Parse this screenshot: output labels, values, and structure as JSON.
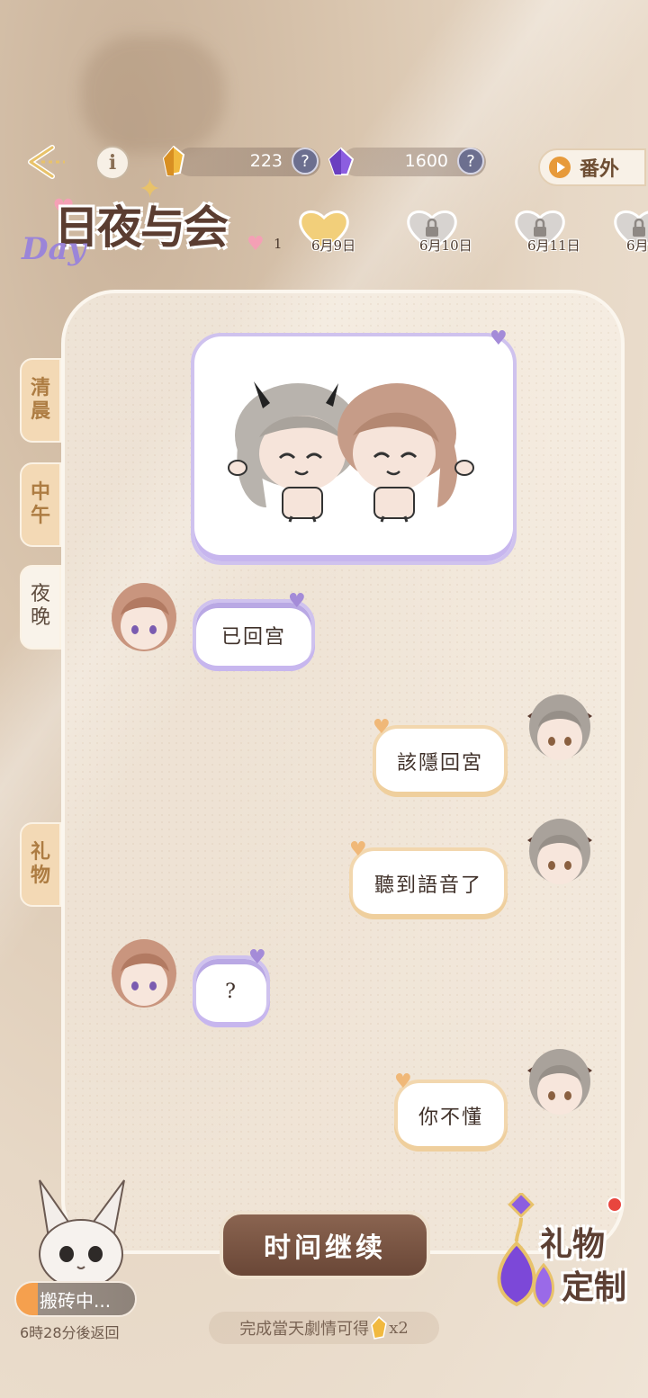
{
  "header": {
    "info_icon_text": "i",
    "gold_amount": "223",
    "gem_amount": "1600",
    "help_symbol": "?",
    "extra_button_label": "番外"
  },
  "logo": {
    "day_text": "Day",
    "title": "日夜与会"
  },
  "dates": {
    "partial_left": "1",
    "items": [
      "6月9日",
      "6月10日",
      "6月11日",
      "6月"
    ]
  },
  "side_tabs": {
    "morning": "清晨",
    "noon": "中午",
    "night": "夜晚",
    "gift": "礼物"
  },
  "chat": {
    "messages": [
      {
        "side": "left",
        "text": "已回宫"
      },
      {
        "side": "right",
        "text": "該隱回宮"
      },
      {
        "side": "right",
        "text": "聽到語音了"
      },
      {
        "side": "left",
        "text": "?"
      },
      {
        "side": "right",
        "text": "你不懂"
      }
    ]
  },
  "footer": {
    "continue_label": "时间继续",
    "reward_hint": "完成當天劇情可得",
    "reward_count": "x2",
    "status_label": "搬砖中...",
    "return_text": "6時28分後返回",
    "gift_custom_line1": "礼物",
    "gift_custom_line2": "定制"
  },
  "colors": {
    "left_bubble_border": "#cfc2ee",
    "right_bubble_border": "#f2d7ae",
    "continue_button": "#6a4737",
    "status_accent": "#f5a04e"
  }
}
